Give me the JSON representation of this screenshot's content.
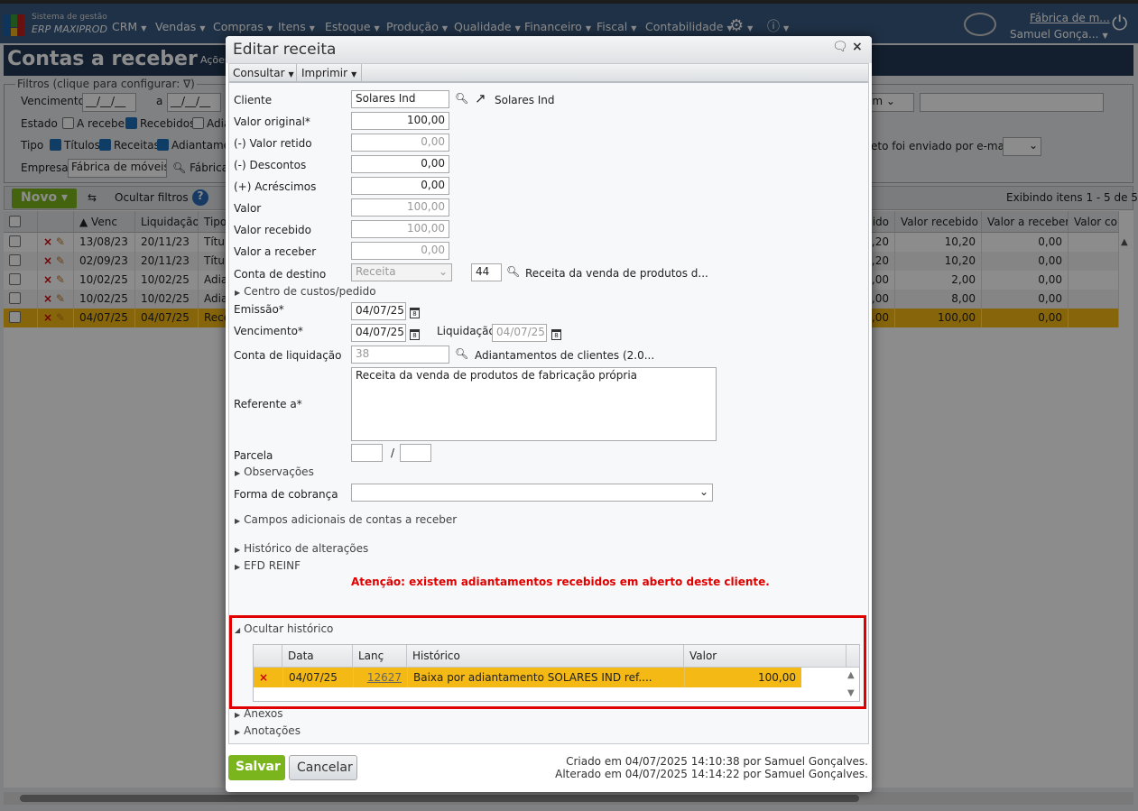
{
  "app": {
    "logo_line1": "Sistema de gestão",
    "logo_line2": "ERP MAXIPROD",
    "menu": [
      "CRM",
      "Vendas",
      "Compras",
      "Itens",
      "Estoque",
      "Produção",
      "Qualidade",
      "Financeiro",
      "Fiscal",
      "Contabilidade"
    ],
    "company": "Fábrica de m...",
    "user": "Samuel Gonça..."
  },
  "page": {
    "title": "Contas a receber",
    "actions": "Ações",
    "filters": {
      "legend": "Filtros (clique para configurar:",
      "vencimento_label": "Vencimento",
      "date_placeholder": "__/__/__",
      "a": "a",
      "estado_label": "Estado",
      "estado": [
        {
          "label": "A receber",
          "checked": false
        },
        {
          "label": "Recebidos",
          "checked": true
        },
        {
          "label": "Adia",
          "checked": false
        }
      ],
      "tipo_label": "Tipo",
      "tipo": [
        {
          "label": "Títulos",
          "checked": true
        },
        {
          "label": "Receitas",
          "checked": true
        },
        {
          "label": "Adiantame",
          "checked": true
        }
      ],
      "empresa_label": "Empresa",
      "empresa_value": "Fábrica de móveis -",
      "empresa_name": "Fábrica",
      "select_partial": "ém",
      "email_label": "eto foi enviado por e-mail"
    },
    "toolbar": {
      "novo": "Novo",
      "hide_filters": "Ocultar filtros",
      "showing": "Exibindo itens 1 - 5 de 5"
    },
    "grid": {
      "headers": {
        "venc": "Venc",
        "liq": "Liquidação",
        "tipo": "Tipo",
        "ido": "ido",
        "recebido": "Valor recebido",
        "areceber": "Valor a receber",
        "cor": "Valor cor"
      },
      "rows": [
        {
          "venc": "13/08/23",
          "liq": "20/11/23",
          "tipo": "Títul",
          "ido": ",20",
          "recebido": "10,20",
          "areceber": "0,00"
        },
        {
          "venc": "02/09/23",
          "liq": "20/11/23",
          "tipo": "Títul",
          "ido": ",20",
          "recebido": "10,20",
          "areceber": "0,00"
        },
        {
          "venc": "10/02/25",
          "liq": "10/02/25",
          "tipo": "Adia",
          "ido": ",00",
          "recebido": "2,00",
          "areceber": "0,00"
        },
        {
          "venc": "10/02/25",
          "liq": "10/02/25",
          "tipo": "Adia",
          "ido": ",00",
          "recebido": "8,00",
          "areceber": "0,00"
        },
        {
          "venc": "04/07/25",
          "liq": "04/07/25",
          "tipo": "Rece",
          "ido": ",00",
          "recebido": "100,00",
          "areceber": "0,00"
        }
      ]
    }
  },
  "dialog": {
    "title": "Editar receita",
    "consultar": "Consultar",
    "imprimir": "Imprimir",
    "fields": {
      "cliente_label": "Cliente",
      "cliente": "Solares Ind",
      "cliente_name": "Solares Ind",
      "valor_original_label": "Valor original*",
      "valor_original": "100,00",
      "valor_retido_label": "(-) Valor retido",
      "valor_retido": "0,00",
      "descontos_label": "(-) Descontos",
      "descontos": "0,00",
      "acrescimos_label": "(+) Acréscimos",
      "acrescimos": "0,00",
      "valor_label": "Valor",
      "valor": "100,00",
      "valor_recebido_label": "Valor recebido",
      "valor_recebido": "100,00",
      "valor_a_receber_label": "Valor a receber",
      "valor_a_receber": "0,00",
      "conta_destino_label": "Conta de destino",
      "conta_destino_tipo": "Receita",
      "conta_destino_num": "44",
      "conta_destino_name": "Receita da venda de produtos d...",
      "centro_custos": "Centro de custos/pedido",
      "emissao_label": "Emissão*",
      "emissao": "04/07/25",
      "vencimento_label": "Vencimento*",
      "vencimento": "04/07/25",
      "liquidacao_label": "Liquidação",
      "liquidacao": "04/07/25",
      "conta_liq_label": "Conta de liquidação",
      "conta_liq_num": "38",
      "conta_liq_name": "Adiantamentos de clientes (2.0...",
      "referente_label": "Referente a*",
      "referente": "Receita da venda de produtos de fabricação própria",
      "parcela_label": "Parcela",
      "parcela_sep": "/",
      "observacoes": "Observações",
      "forma_cobranca_label": "Forma de cobrança",
      "campos_adicionais": "Campos adicionais de contas a receber",
      "historico_alteracoes": "Histórico de alterações",
      "efd_reinf": "EFD REINF",
      "warning": "Atenção: existem adiantamentos recebidos em aberto deste cliente."
    },
    "history": {
      "toggle": "Ocultar histórico",
      "headers": {
        "data": "Data",
        "lanc": "Lanç",
        "historico": "Histórico",
        "valor": "Valor"
      },
      "rows": [
        {
          "data": "04/07/25",
          "lanc": "12627",
          "historico": "Baixa por adiantamento SOLARES IND ref....",
          "valor": "100,00"
        }
      ]
    },
    "anexos": "Anexos",
    "anotacoes": "Anotações",
    "salvar": "Salvar",
    "cancelar": "Cancelar",
    "created": "Criado em 04/07/2025 14:10:38 por Samuel Gonçalves.",
    "changed": "Alterado em 04/07/2025 14:14:22 por Samuel Gonçalves."
  },
  "colors": {
    "accent": "#7ab51d",
    "highlight": "#f4b915",
    "warning": "#e00000",
    "nav": "#3a5a80"
  }
}
